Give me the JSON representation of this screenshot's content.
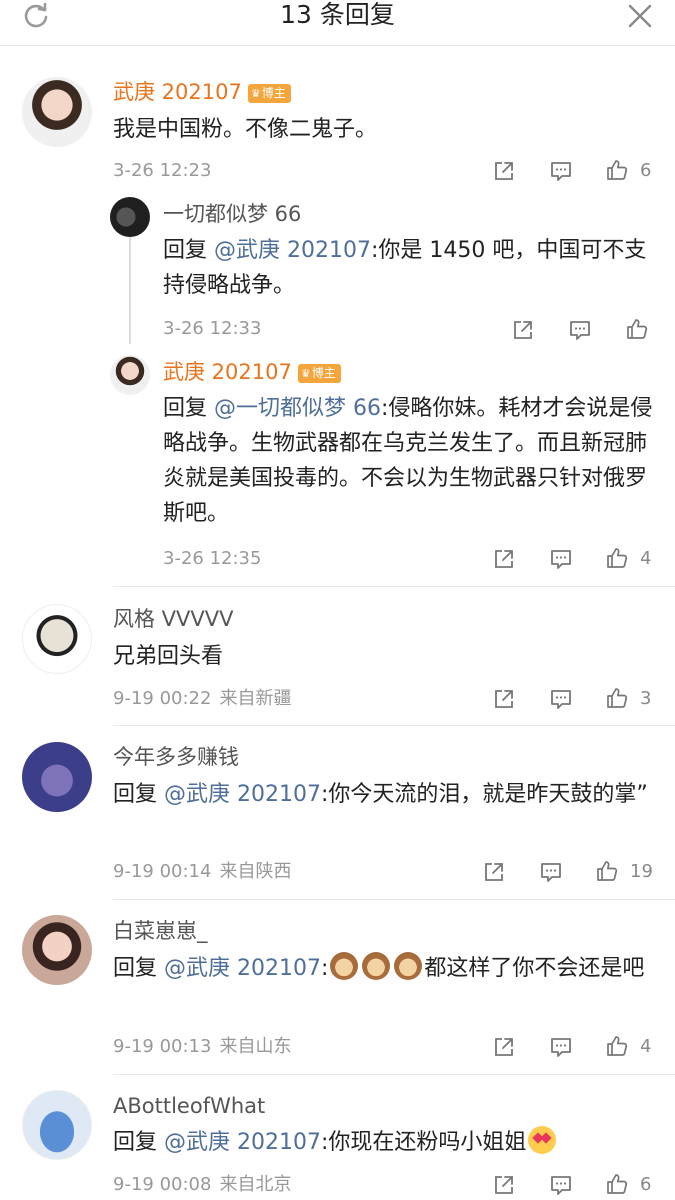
{
  "header": {
    "title": "13 条回复",
    "refresh_icon": "refresh-icon",
    "close_icon": "close-icon"
  },
  "badge_label": "博主",
  "comments": [
    {
      "author": "武庚 202107",
      "is_blogger": true,
      "text": "我是中国粉。不像二鬼子。",
      "time": "3-26 12:23",
      "source": "",
      "likes": "6",
      "replies": [
        {
          "author": "一切都似梦 66",
          "reply_prefix": "回复 ",
          "mention": "@武庚 202107",
          "text": ":你是 1450 吧，中国可不支持侵略战争。",
          "time": "3-26 12:33",
          "likes": ""
        },
        {
          "author": "武庚 202107",
          "is_blogger": true,
          "reply_prefix": "回复 ",
          "mention": "@一切都似梦 66",
          "text": ":侵略你妹。耗材才会说是侵略战争。生物武器都在乌克兰发生了。而且新冠肺炎就是美国投毒的。不会以为生物武器只针对俄罗斯吧。",
          "time": "3-26 12:35",
          "likes": "4"
        }
      ]
    },
    {
      "author": "风格 VVVVV",
      "text": "兄弟回头看",
      "time": "9-19 00:22",
      "source": "来自新疆",
      "likes": "3"
    },
    {
      "author": "今年多多赚钱",
      "reply_prefix": "回复 ",
      "mention": "@武庚 202107",
      "text": ":你今天流的泪，就是昨天鼓的掌”",
      "time": "9-19 00:14",
      "source": "来自陕西",
      "likes": "19"
    },
    {
      "author": "白菜崽崽_",
      "reply_prefix": "回复 ",
      "mention": "@武庚 202107",
      "text_pre": ":",
      "emoji": [
        "see-no-evil-monkey",
        "see-no-evil-monkey",
        "see-no-evil-monkey"
      ],
      "text": "都这样了你不会还是吧",
      "time": "9-19 00:13",
      "source": "来自山东",
      "likes": "4"
    },
    {
      "author": "ABottleofWhat",
      "reply_prefix": "回复 ",
      "mention": "@武庚 202107",
      "text": ":你现在还粉吗小姐姐",
      "emoji_after": "heart-eyes-emoji",
      "time": "9-19 00:08",
      "source": "来自北京",
      "likes": "6"
    }
  ],
  "colors": {
    "accent_name": "#e8741e",
    "mention": "#4f6f9a",
    "badge": "#f4a53c",
    "meta": "#999999"
  }
}
